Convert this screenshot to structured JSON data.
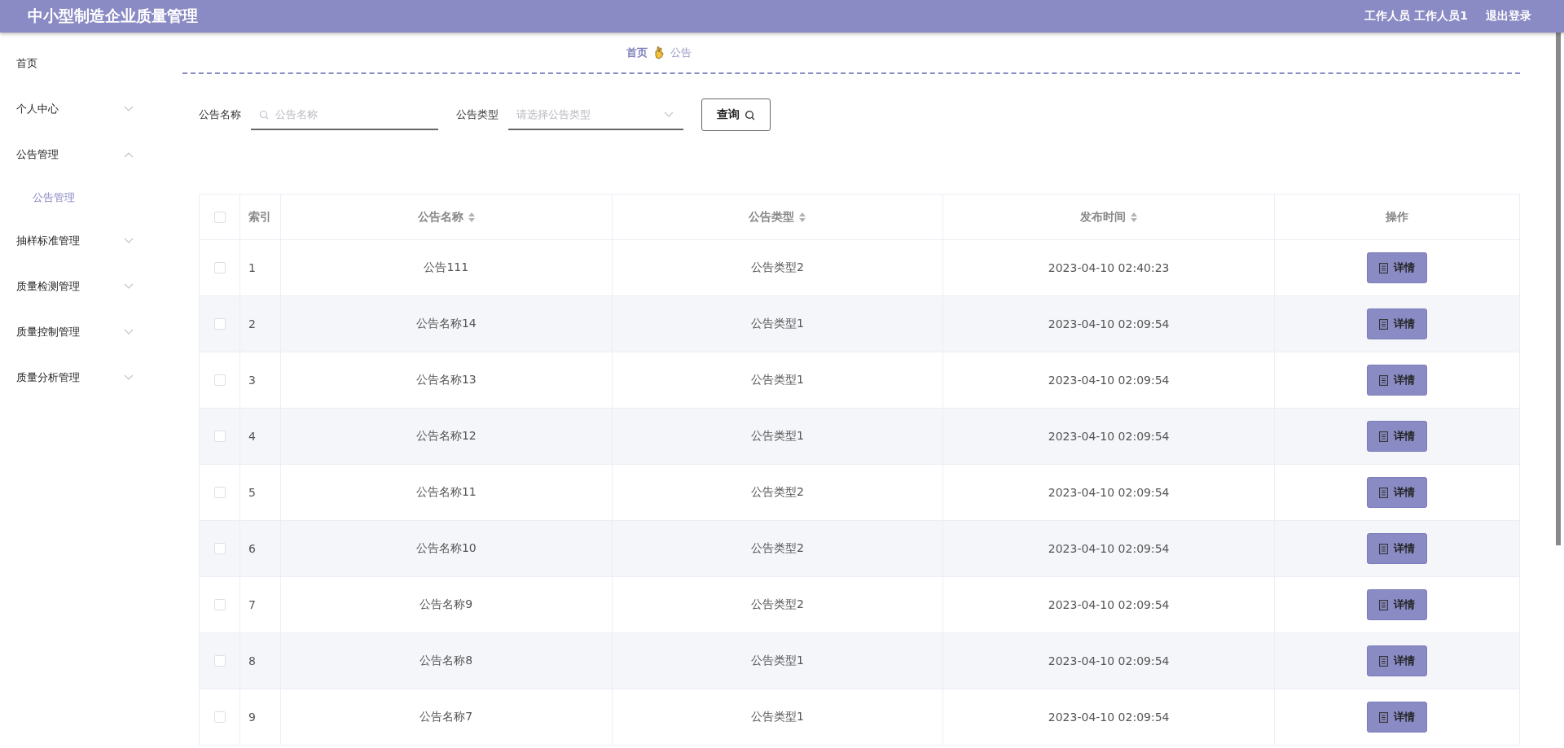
{
  "header": {
    "title": "中小型制造企业质量管理",
    "user": "工作人员 工作人员1",
    "logout": "退出登录"
  },
  "sidebar": {
    "items": [
      {
        "label": "首页",
        "kind": "link"
      },
      {
        "label": "个人中心",
        "kind": "menu",
        "expanded": false
      },
      {
        "label": "公告管理",
        "kind": "menu",
        "expanded": true,
        "children": [
          {
            "label": "公告管理",
            "selected": true
          }
        ]
      },
      {
        "label": "抽样标准管理",
        "kind": "menu",
        "expanded": false
      },
      {
        "label": "质量检测管理",
        "kind": "menu",
        "expanded": false
      },
      {
        "label": "质量控制管理",
        "kind": "menu",
        "expanded": false
      },
      {
        "label": "质量分析管理",
        "kind": "menu",
        "expanded": false
      }
    ]
  },
  "breadcrumb": [
    "首页",
    "公告"
  ],
  "search": {
    "name_label": "公告名称",
    "name_placeholder": "公告名称",
    "type_label": "公告类型",
    "type_placeholder": "请选择公告类型",
    "button": "查询"
  },
  "table": {
    "select_all_checked": false,
    "columns": [
      {
        "label": "索引",
        "sortable": false
      },
      {
        "label": "公告名称",
        "sortable": true
      },
      {
        "label": "公告类型",
        "sortable": true
      },
      {
        "label": "发布时间",
        "sortable": true
      },
      {
        "label": "操作",
        "sortable": false
      }
    ],
    "rows": [
      {
        "checked": false,
        "index": "1",
        "name": "公告111",
        "type": "公告类型2",
        "time": "2023-04-10 02:40:23",
        "action": "详情"
      },
      {
        "checked": false,
        "index": "2",
        "name": "公告名称14",
        "type": "公告类型1",
        "time": "2023-04-10 02:09:54",
        "action": "详情"
      },
      {
        "checked": false,
        "index": "3",
        "name": "公告名称13",
        "type": "公告类型1",
        "time": "2023-04-10 02:09:54",
        "action": "详情"
      },
      {
        "checked": false,
        "index": "4",
        "name": "公告名称12",
        "type": "公告类型1",
        "time": "2023-04-10 02:09:54",
        "action": "详情"
      },
      {
        "checked": false,
        "index": "5",
        "name": "公告名称11",
        "type": "公告类型2",
        "time": "2023-04-10 02:09:54",
        "action": "详情"
      },
      {
        "checked": false,
        "index": "6",
        "name": "公告名称10",
        "type": "公告类型2",
        "time": "2023-04-10 02:09:54",
        "action": "详情"
      },
      {
        "checked": false,
        "index": "7",
        "name": "公告名称9",
        "type": "公告类型2",
        "time": "2023-04-10 02:09:54",
        "action": "详情"
      },
      {
        "checked": false,
        "index": "8",
        "name": "公告名称8",
        "type": "公告类型1",
        "time": "2023-04-10 02:09:54",
        "action": "详情"
      },
      {
        "checked": false,
        "index": "9",
        "name": "公告名称7",
        "type": "公告类型1",
        "time": "2023-04-10 02:09:54",
        "action": "详情"
      }
    ]
  }
}
